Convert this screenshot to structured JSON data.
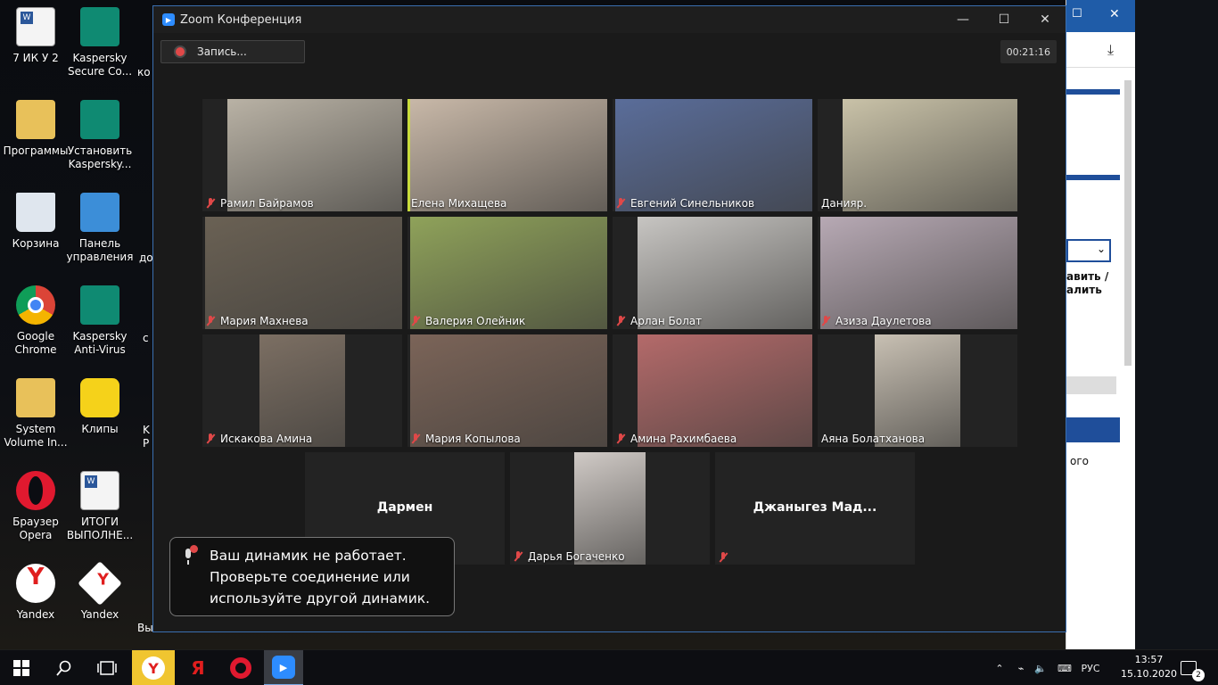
{
  "desktop": {
    "icons": [
      {
        "label": "7 ИК У 2",
        "icon": "word-document-icon"
      },
      {
        "label": "Kaspersky Secure Co...",
        "icon": "kaspersky-lock-icon"
      },
      {
        "label": "Программы",
        "icon": "folder-icon"
      },
      {
        "label": "Установить Kaspersky...",
        "icon": "kaspersky-install-icon"
      },
      {
        "label": "Корзина",
        "icon": "recycle-bin-icon"
      },
      {
        "label": "Панель управления",
        "icon": "control-panel-icon"
      },
      {
        "label": "Google Chrome",
        "icon": "chrome-icon"
      },
      {
        "label": "Kaspersky Anti-Virus",
        "icon": "kaspersky-antivirus-icon"
      },
      {
        "label": "System Volume In...",
        "icon": "folder-icon"
      },
      {
        "label": "Клипы",
        "icon": "folder-smiley-icon"
      },
      {
        "label": "Браузер Opera",
        "icon": "opera-icon"
      },
      {
        "label": "ИТОГИ ВЫПОЛНЕ...",
        "icon": "word-document-icon"
      },
      {
        "label": "Yandex",
        "icon": "yandex-icon"
      },
      {
        "label": "Yandex",
        "icon": "yandex-box-icon"
      }
    ],
    "partial_labels": [
      "ко",
      "до",
      "с",
      "K",
      "Р",
      "Вы"
    ]
  },
  "zoom": {
    "title": "Zoom Конференция",
    "record_label": "Запись...",
    "timer": "00:21:16",
    "participants": [
      {
        "name": "Рамил Байрамов",
        "muted": true,
        "active": false,
        "video": true,
        "color": "#b9b2a5"
      },
      {
        "name": "Елена Михащева",
        "muted": false,
        "active": true,
        "video": true,
        "color": "#c8b8a8"
      },
      {
        "name": "Евгений Синельников",
        "muted": true,
        "active": false,
        "video": true,
        "color": "#5a6d9a"
      },
      {
        "name": "Данияр.",
        "muted": false,
        "active": false,
        "video": true,
        "color": "#c9c2a8"
      },
      {
        "name": "Мария Махнева",
        "muted": true,
        "active": false,
        "video": true,
        "color": "#6a6154"
      },
      {
        "name": "Валерия Олейник",
        "muted": true,
        "active": false,
        "video": true,
        "color": "#8fa25a"
      },
      {
        "name": "Арлан Болат",
        "muted": true,
        "active": false,
        "video": true,
        "color": "#c7c5c2"
      },
      {
        "name": "Азиза Даулетова",
        "muted": true,
        "active": false,
        "video": true,
        "color": "#b7a9b4"
      },
      {
        "name": "Искакова Амина",
        "muted": true,
        "active": false,
        "video": true,
        "color": "#7c6f63"
      },
      {
        "name": "Мария Копылова",
        "muted": true,
        "active": false,
        "video": true,
        "color": "#7b6458"
      },
      {
        "name": "Амина Рахимбаева",
        "muted": true,
        "active": false,
        "video": true,
        "color": "#b46a6a"
      },
      {
        "name": "Аяна Болатханова",
        "muted": false,
        "active": false,
        "video": true,
        "color": "#c8c0b3"
      },
      {
        "name": "Дармен",
        "muted": false,
        "active": false,
        "video": false,
        "color": "#232323"
      },
      {
        "name": "Дарья Богаченко",
        "muted": true,
        "active": false,
        "video": true,
        "color": "#d0cac6"
      },
      {
        "name": "Джаныгез Мад...",
        "muted": true,
        "active": false,
        "video": false,
        "color": "#232323"
      }
    ],
    "toast": {
      "line1": "Ваш динамик не работает.",
      "line2": "Проверьте соединение или",
      "line3": "используйте другой динамик."
    }
  },
  "background_browser": {
    "text_fragments": [
      "авить /",
      "алить",
      "ого"
    ]
  },
  "taskbar": {
    "apps": [
      "start-icon",
      "search-icon",
      "task-view-icon",
      "yandex-browser-icon",
      "yandex-icon",
      "opera-icon",
      "zoom-icon"
    ],
    "language": "РУС",
    "time": "13:57",
    "date": "15.10.2020",
    "notifications": "2"
  }
}
